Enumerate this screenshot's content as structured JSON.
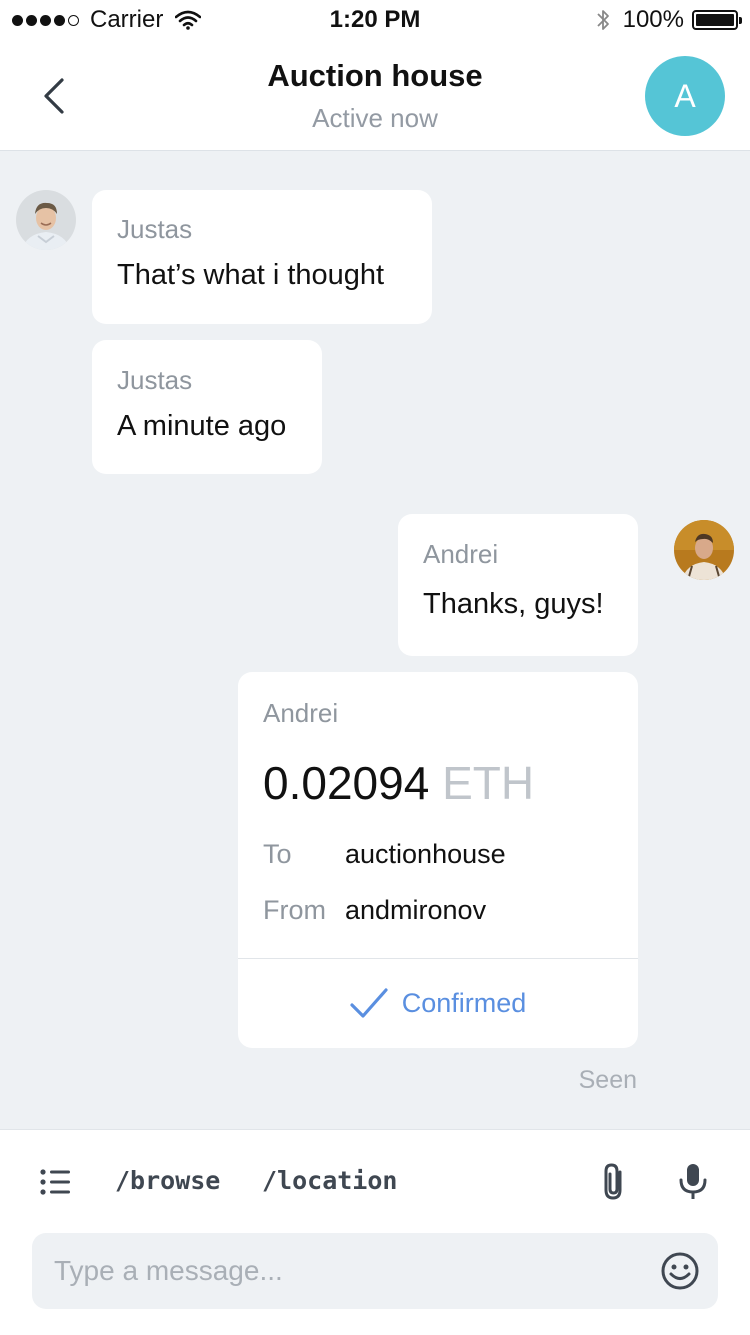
{
  "status_bar": {
    "carrier": "Carrier",
    "time": "1:20 PM",
    "battery": "100%"
  },
  "header": {
    "title": "Auction house",
    "subtitle": "Active now",
    "avatar_letter": "A",
    "avatar_color": "#55c5d6"
  },
  "messages": [
    {
      "sender": "Justas",
      "text": "That’s what i thought"
    },
    {
      "sender": "Justas",
      "text": "A minute ago"
    },
    {
      "sender": "Andrei",
      "text": "Thanks, guys!"
    }
  ],
  "transaction": {
    "sender": "Andrei",
    "amount": "0.02094",
    "currency": "ETH",
    "to_label": "To",
    "to_value": "auctionhouse",
    "from_label": "From",
    "from_value": "andmironov",
    "status": "Confirmed",
    "status_color": "#5a8fe0"
  },
  "seen_label": "Seen",
  "composer": {
    "commands": [
      "/browse",
      "/location"
    ],
    "placeholder": "Type a message..."
  },
  "icons": [
    "back-icon",
    "list-icon",
    "paperclip-icon",
    "microphone-icon",
    "emoji-icon",
    "checkmark-icon",
    "wifi-icon",
    "bluetooth-icon",
    "battery-icon"
  ]
}
